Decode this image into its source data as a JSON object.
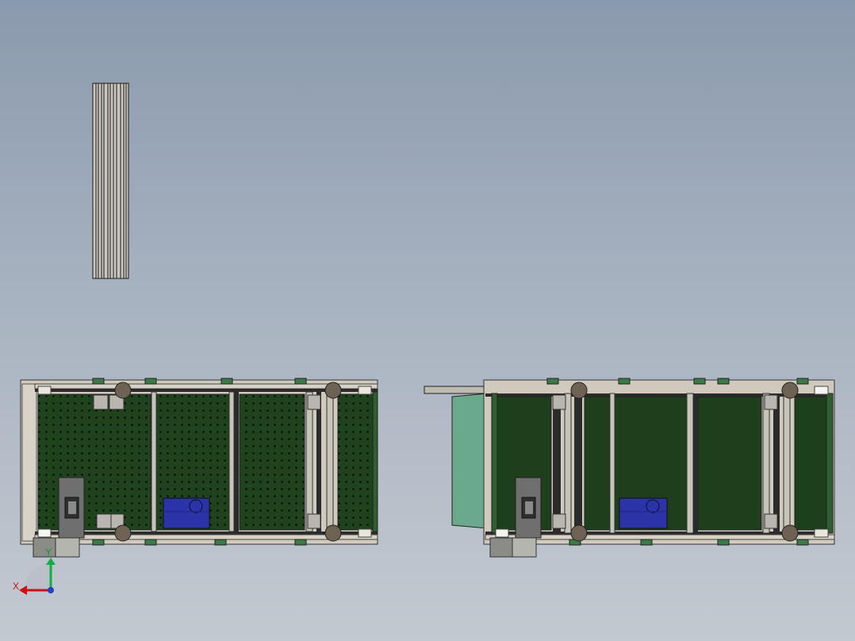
{
  "viewport": {
    "background_top": "#8a99ad",
    "background_bottom": "#c3c9d1"
  },
  "parts": {
    "aluminum_profile": {
      "name": "aluminum-profile-view"
    },
    "conveyor_left": {
      "name": "conveyor-top-view-perforated"
    },
    "conveyor_right": {
      "name": "conveyor-top-view-plain"
    }
  },
  "colors": {
    "bed_dark_green": "#1d3f1b",
    "panel_green": "#2f5f2f",
    "frame_gray": "#b9b6aa",
    "rail_dark": "#2b2b2b",
    "roller_brown": "#6e6254",
    "motor_blue": "#2a34a6",
    "guard_light_green": "#6aa98c",
    "x_axis": "#d01010",
    "y_axis": "#10b040"
  },
  "triad": {
    "x_label": "X",
    "y_label": "Y",
    "x_icon": "x-axis-arrow-icon",
    "y_icon": "y-axis-arrow-icon"
  }
}
